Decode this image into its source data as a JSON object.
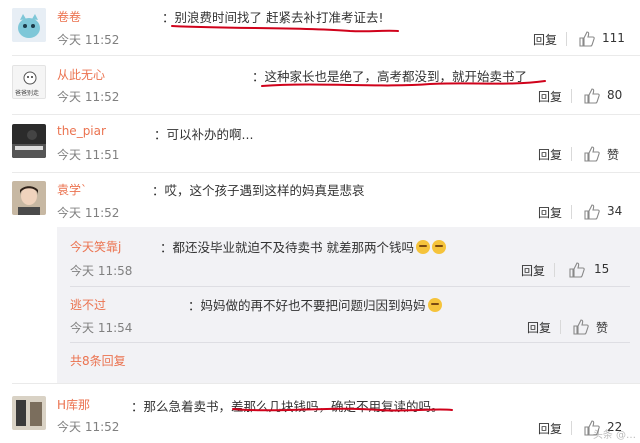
{
  "comments": [
    {
      "name": "卷卷",
      "text": "：别浪费时间找了 赶紧去补打准考证去!",
      "time": "今天 11:52",
      "reply": "回复",
      "likes": "111"
    },
    {
      "name": "从此无心",
      "text": "：这种家长也是绝了，高考都没到，就开始卖书了",
      "time": "今天 11:52",
      "reply": "回复",
      "likes": "80"
    },
    {
      "name": "the_piar",
      "text": "：可以补办的啊...",
      "time": "今天 11:51",
      "reply": "回复",
      "likes": "赞"
    },
    {
      "name": "袁学`",
      "text": "：哎，这个孩子遇到这样的妈真是悲哀",
      "time": "今天 11:52",
      "reply": "回复",
      "likes": "34"
    },
    {
      "name": "H库那",
      "text": "：那么急着卖书，差那么几块钱吗，确定不用复读的吗。",
      "time": "今天 11:52",
      "reply": "回复",
      "likes": "22"
    }
  ],
  "subcomments": [
    {
      "name": "今天笑靠j",
      "text": "：都还没毕业就迫不及待卖书 就差那两个钱吗",
      "time": "今天 11:58",
      "reply": "回复",
      "likes": "15"
    },
    {
      "name": "逃不过",
      "text": "：妈妈做的再不好也不要把问题归因到妈妈",
      "time": "今天 11:54",
      "reply": "回复",
      "likes": "赞"
    }
  ],
  "more_replies": "共8条回复",
  "avatar_labels": {
    "c2": "爸爸别走"
  },
  "watermark": "头条 @…",
  "colors": {
    "name": "#eb7350",
    "underline": "#d0021b",
    "panel": "#f2f2f5"
  }
}
